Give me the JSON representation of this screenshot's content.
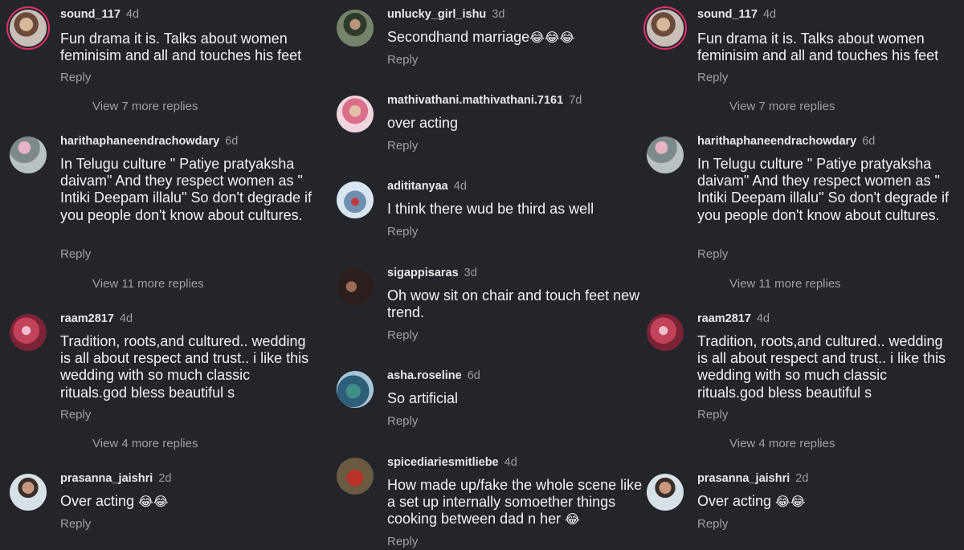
{
  "reply_label": "Reply",
  "c_sound": {
    "user": "sound_117",
    "time": "4d",
    "text": "Fun drama it is. Talks about women feminisim and all and touches his feet",
    "more": "View 7 more replies"
  },
  "c_haritha": {
    "user": "harithaphaneendrachowdary",
    "time": "6d",
    "text": "In Telugu culture \" Patiye pratyaksha daivam\"  And they respect women as \" Intiki Deepam illalu\" So don't degrade if you people don't know about cultures.",
    "more": "View 11 more replies"
  },
  "c_raam": {
    "user": "raam2817",
    "time": "4d",
    "text": "Tradition, roots,and cultured.. wedding is all about respect and trust.. i like this wedding with so much classic rituals.god bless beautiful s",
    "more": "View 4 more replies"
  },
  "c_prasanna": {
    "user": "prasanna_jaishri",
    "time": "2d",
    "text": "Over acting ",
    "emoji": "😂😂"
  },
  "c_unlucky": {
    "user": "unlucky_girl_ishu",
    "time": "3d",
    "text": "Secondhand marriage",
    "emoji": "😂😂😂"
  },
  "c_mathi": {
    "user": "mathivathani.mathivathani.7161",
    "time": "7d",
    "text": "over acting"
  },
  "c_aditi": {
    "user": "adititanyaa",
    "time": "4d",
    "text": "I think there wud be third as well"
  },
  "c_siga": {
    "user": "sigappisaras",
    "time": "3d",
    "text": "Oh wow sit on chair and touch feet new trend."
  },
  "c_asha": {
    "user": "asha.roseline",
    "time": "6d",
    "text": "So artificial"
  },
  "c_spice": {
    "user": "spicediariesmitliebe",
    "time": "4d",
    "text": "How made up/fake the whole scene like a set up internally somoether things cooking between dad n her ",
    "emoji": "😂"
  }
}
